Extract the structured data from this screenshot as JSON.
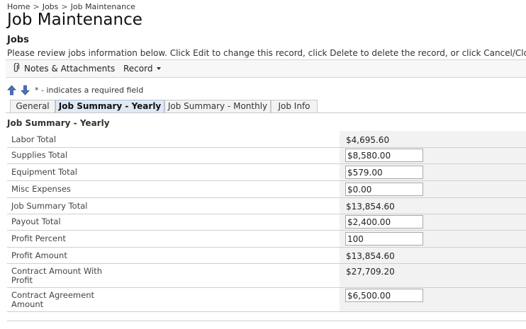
{
  "breadcrumb": {
    "home": "Home",
    "jobs": "Jobs",
    "current": "Job Maintenance",
    "separator": ">"
  },
  "page_title": "Job Maintenance",
  "section_title": "Jobs",
  "instructions": "Please review jobs information below. Click Edit to change this record, click Delete to delete the record, or click Cancel/Close to return",
  "toolbar": {
    "notes_label": "Notes & Attachments",
    "record_label": "Record"
  },
  "required_note": "* - indicates a required field",
  "tabs": [
    {
      "label": "General",
      "active": false
    },
    {
      "label": "Job Summary - Yearly",
      "active": true
    },
    {
      "label": "Job Summary - Monthly",
      "active": false
    },
    {
      "label": "Job Info",
      "active": false
    }
  ],
  "summary_heading": "Job Summary - Yearly",
  "fields": {
    "labor_total": {
      "label": "Labor Total",
      "value": "$4,695.60"
    },
    "supplies_total": {
      "label": "Supplies Total",
      "value": "$8,580.00"
    },
    "equipment_total": {
      "label": "Equipment Total",
      "value": "$579.00"
    },
    "misc_expenses": {
      "label": "Misc Expenses",
      "value": "$0.00"
    },
    "job_summary_total": {
      "label": "Job Summary Total",
      "value": "$13,854.60"
    },
    "payout_total": {
      "label": "Payout Total",
      "value": "$2,400.00"
    },
    "profit_percent": {
      "label": "Profit Percent",
      "value": "100"
    },
    "profit_amount": {
      "label": "Profit Amount",
      "value": "$13,854.60"
    },
    "contract_amount_with_profit": {
      "label_line1": "Contract Amount With",
      "label_line2": "Profit",
      "value": "$27,709.20"
    },
    "contract_agreement_amount": {
      "label_line1": "Contract Agreement",
      "label_line2": "Amount",
      "value": "$6,500.00"
    }
  },
  "colors": {
    "active_tab_bg": "#dfe9f5",
    "value_cell_bg": "#f2f2f2",
    "arrow_blue": "#4a72b8"
  }
}
